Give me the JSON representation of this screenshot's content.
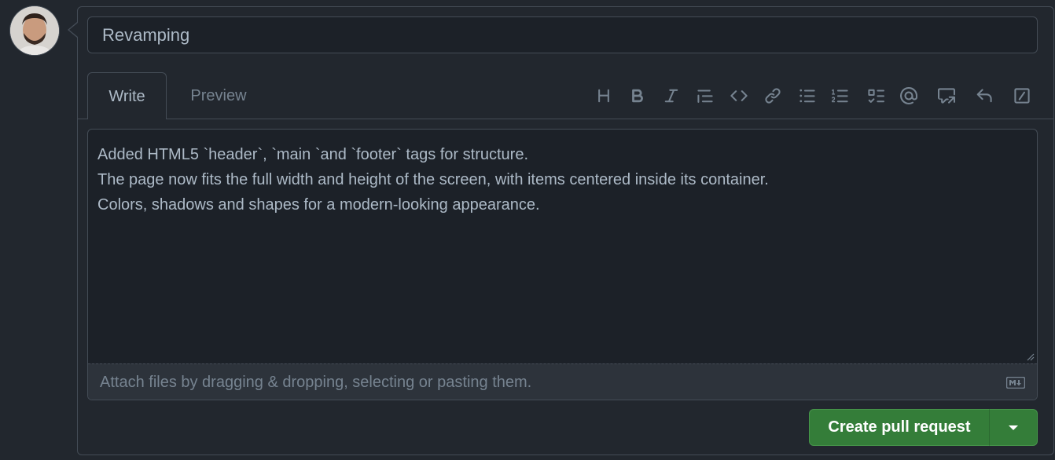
{
  "comment": {
    "title_value": "Revamping",
    "tabs": {
      "write": "Write",
      "preview": "Preview"
    },
    "toolbar_icons": [
      "heading-icon",
      "bold-icon",
      "italic-icon",
      "quote-icon",
      "code-icon",
      "link-icon",
      "unordered-list-icon",
      "ordered-list-icon",
      "task-list-icon",
      "mention-icon",
      "reference-icon",
      "saved-replies-icon",
      "slash-commands-icon"
    ],
    "body_lines": [
      "Added HTML5 `header`, `main `and `footer` tags for structure.",
      "The page now fits the full width and height of the screen, with items centered inside its container.",
      "Colors, shadows and shapes for a modern-looking appearance."
    ],
    "attach_hint": "Attach files by dragging & dropping, selecting or pasting them.",
    "submit_label": "Create pull request"
  },
  "colors": {
    "background": "#22272e",
    "editor_bg": "#1c2128",
    "border": "#444c56",
    "button_green": "#347d39"
  }
}
